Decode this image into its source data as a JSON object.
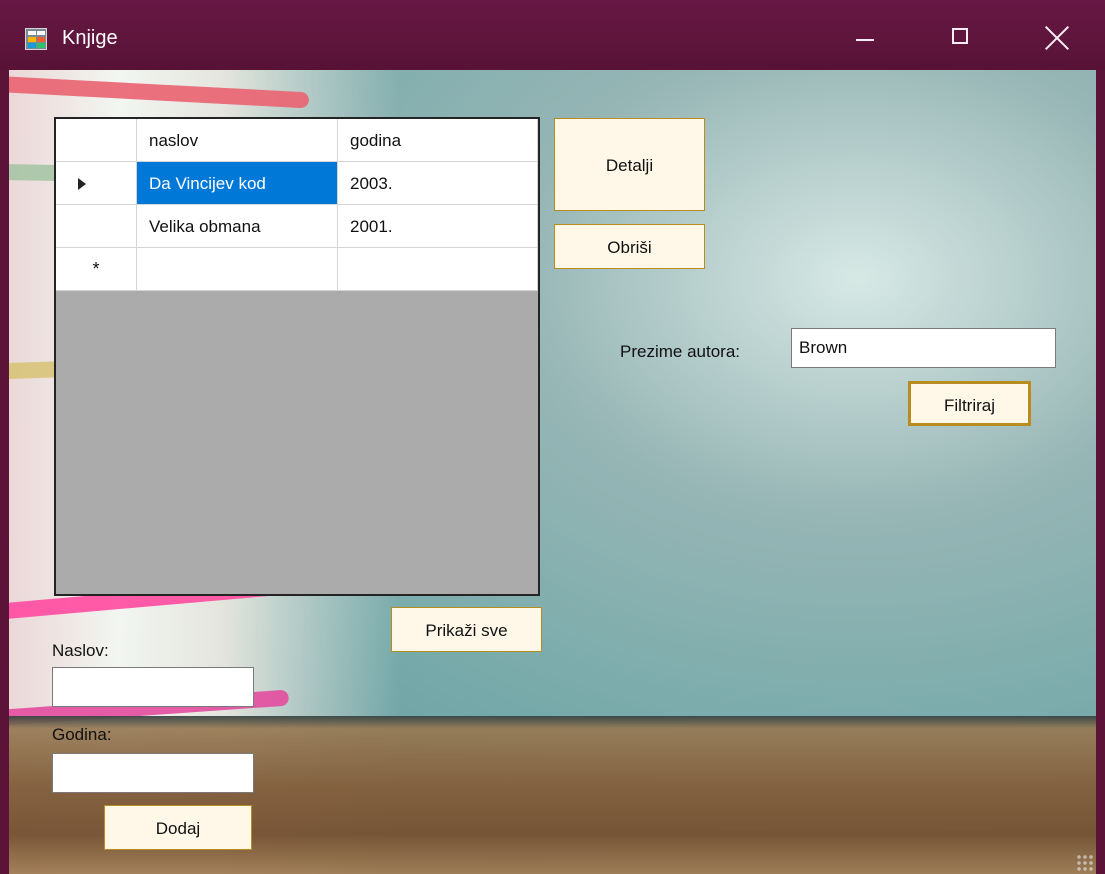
{
  "window": {
    "title": "Knjige",
    "icon": "windows-form-icon",
    "controls": {
      "minimize": "minimize-icon",
      "maximize": "maximize-icon",
      "close": "close-icon"
    }
  },
  "grid": {
    "columns": [
      "naslov",
      "godina"
    ],
    "rows": [
      {
        "marker": "row-arrow-icon",
        "naslov": "Da Vincijev kod",
        "godina": "2003."
      },
      {
        "marker": "",
        "naslov": "Velika obmana",
        "godina": "2001."
      }
    ],
    "new_row_marker": "*",
    "selected_row": 0,
    "selected_column": "naslov"
  },
  "buttons": {
    "detalji": "Detalji",
    "obrisi": "Obriši",
    "filtriraj": "Filtriraj",
    "prikazi_sve": "Prikaži sve",
    "dodaj": "Dodaj"
  },
  "filter": {
    "label": "Prezime autora:",
    "value": "Brown"
  },
  "add_form": {
    "naslov_label": "Naslov:",
    "naslov_value": "",
    "godina_label": "Godina:",
    "godina_value": ""
  },
  "colors": {
    "titlebar": "#5b1338",
    "selected_cell": "#0078d7",
    "button_background": "#fff8e8",
    "button_border": "#b88c1f",
    "grid_background": "#ababab"
  }
}
